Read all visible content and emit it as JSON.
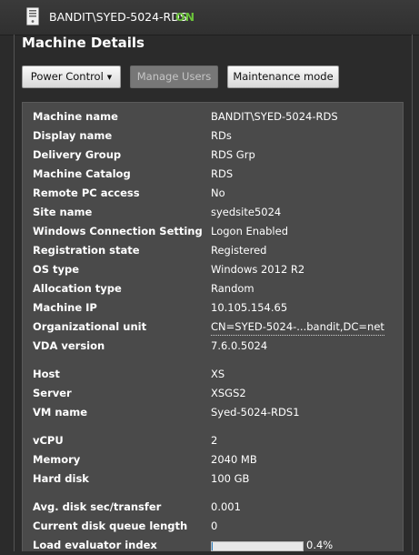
{
  "header": {
    "machine_name": "BANDIT\\SYED-5024-RDS",
    "status": "ON",
    "status_color": "#6ac23a",
    "icon": "server-icon"
  },
  "section_title": "Machine Details",
  "buttons": {
    "power_control": "Power Control",
    "manage_users": "Manage Users",
    "maintenance_mode": "Maintenance mode"
  },
  "details": {
    "group1": [
      {
        "label": "Machine name",
        "value": "BANDIT\\SYED-5024-RDS"
      },
      {
        "label": "Display name",
        "value": "RDs"
      },
      {
        "label": "Delivery Group",
        "value": "RDS Grp"
      },
      {
        "label": "Machine Catalog",
        "value": "RDS"
      },
      {
        "label": "Remote PC access",
        "value": "No"
      },
      {
        "label": "Site name",
        "value": "syedsite5024"
      },
      {
        "label": "Windows Connection Setting",
        "value": "Logon Enabled"
      },
      {
        "label": "Registration state",
        "value": "Registered"
      },
      {
        "label": "OS type",
        "value": "Windows 2012 R2"
      },
      {
        "label": "Allocation type",
        "value": "Random"
      },
      {
        "label": "Machine IP",
        "value": "10.105.154.65"
      },
      {
        "label": "Organizational unit",
        "value": "CN=SYED-5024-...bandit,DC=net"
      },
      {
        "label": "VDA version",
        "value": "7.6.0.5024"
      }
    ],
    "group2": [
      {
        "label": "Host",
        "value": "XS"
      },
      {
        "label": "Server",
        "value": "XSGS2"
      },
      {
        "label": "VM name",
        "value": "Syed-5024-RDS1"
      }
    ],
    "group3": [
      {
        "label": "vCPU",
        "value": "2"
      },
      {
        "label": "Memory",
        "value": "2040 MB"
      },
      {
        "label": "Hard disk",
        "value": "100 GB"
      }
    ],
    "group4": [
      {
        "label": "Avg. disk sec/transfer",
        "value": "0.001"
      },
      {
        "label": "Current disk queue length",
        "value": "0"
      },
      {
        "label": "Load evaluator index",
        "value": "0.4%",
        "bar_fraction": 0.004
      }
    ]
  }
}
